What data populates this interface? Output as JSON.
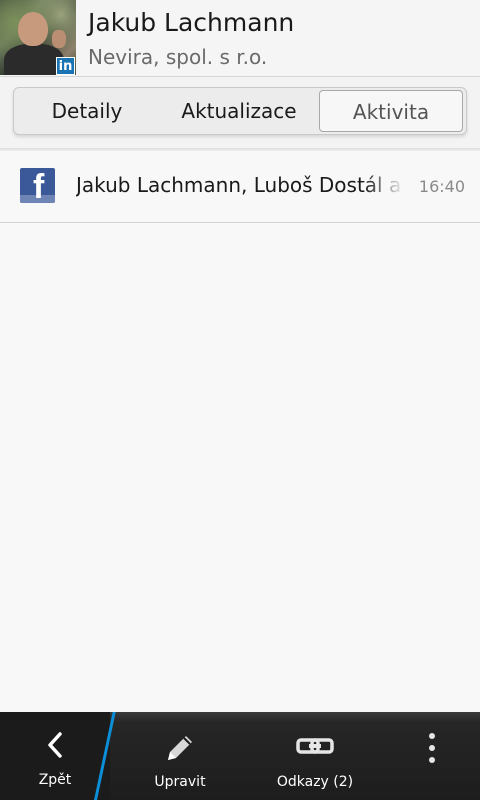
{
  "contact": {
    "name": "Jakub Lachmann",
    "company": "Nevira, spol. s r.o.",
    "source_badge": "in"
  },
  "tabs": [
    {
      "label": "Detaily",
      "selected": false
    },
    {
      "label": "Aktualizace",
      "selected": false
    },
    {
      "label": "Aktivita",
      "selected": true
    }
  ],
  "activity": [
    {
      "icon": "facebook-icon",
      "title": "Jakub Lachmann, Luboš Dostál a",
      "time": "16:40"
    }
  ],
  "action_bar": {
    "back": {
      "label": "Zpět",
      "icon": "chevron-left-icon"
    },
    "edit": {
      "label": "Upravit",
      "icon": "pencil-icon"
    },
    "links": {
      "label": "Odkazy (2)",
      "icon": "link-icon"
    },
    "more": {
      "icon": "overflow-menu-icon"
    }
  },
  "colors": {
    "accent": "#0a8fd8",
    "facebook": "#3b5998",
    "linkedin": "#1a74b4",
    "action_bar": "#1d1d1d"
  }
}
